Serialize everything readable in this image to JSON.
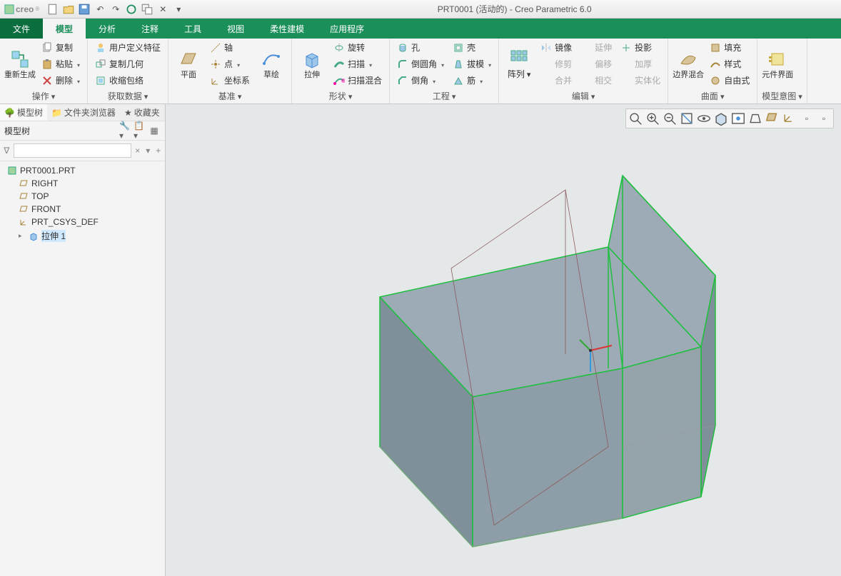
{
  "title": "PRT0001 (活动的) - Creo Parametric 6.0",
  "logo": "creo",
  "tabs": {
    "file": "文件",
    "items": [
      "模型",
      "分析",
      "注释",
      "工具",
      "视图",
      "柔性建模",
      "应用程序"
    ],
    "active": "模型"
  },
  "ribbon": {
    "groups": [
      {
        "label": "操作",
        "big": [
          {
            "l": "重新生成"
          }
        ],
        "small": [
          [
            "复制",
            "粘贴",
            "删除"
          ]
        ]
      },
      {
        "label": "获取数据",
        "small": [
          [
            "用户定义特征",
            "复制几何",
            "收缩包络"
          ]
        ]
      },
      {
        "label": "基准",
        "big": [
          {
            "l": "平面"
          },
          {
            "l": "草绘"
          }
        ],
        "small": [
          [
            "轴",
            "点",
            "坐标系"
          ]
        ]
      },
      {
        "label": "形状",
        "big": [
          {
            "l": "拉伸"
          }
        ],
        "small": [
          [
            "旋转",
            "扫描",
            "扫描混合"
          ]
        ]
      },
      {
        "label": "工程",
        "small": [
          [
            "孔",
            "倒圆角",
            "倒角"
          ],
          [
            "壳",
            "拔模",
            "筋"
          ]
        ]
      },
      {
        "label": "编辑",
        "big": [
          {
            "l": "阵列"
          }
        ],
        "small": [
          [
            "镜像",
            "修剪",
            "合并"
          ],
          [
            "延伸",
            "偏移",
            "相交"
          ],
          [
            "投影",
            "加厚",
            "实体化"
          ]
        ]
      },
      {
        "label": "曲面",
        "big": [
          {
            "l": "边界混合"
          }
        ],
        "small": [
          [
            "填充",
            "样式",
            "自由式"
          ]
        ]
      },
      {
        "label": "模型意图",
        "big": [
          {
            "l": "元件界面"
          }
        ]
      }
    ]
  },
  "leftpanel": {
    "tabs": [
      "模型树",
      "文件夹浏览器",
      "收藏夹"
    ],
    "active": "模型树",
    "title": "模型树",
    "filter_placeholder": "",
    "tree": {
      "root": "PRT0001.PRT",
      "items": [
        {
          "l": "RIGHT",
          "t": "plane"
        },
        {
          "l": "TOP",
          "t": "plane"
        },
        {
          "l": "FRONT",
          "t": "plane"
        },
        {
          "l": "PRT_CSYS_DEF",
          "t": "csys"
        },
        {
          "l": "拉伸 1",
          "t": "feat",
          "sel": true
        }
      ]
    }
  },
  "colors": {
    "accent": "#1a8f5a",
    "edge": "#1fbf3f",
    "face": "#7f909c"
  }
}
